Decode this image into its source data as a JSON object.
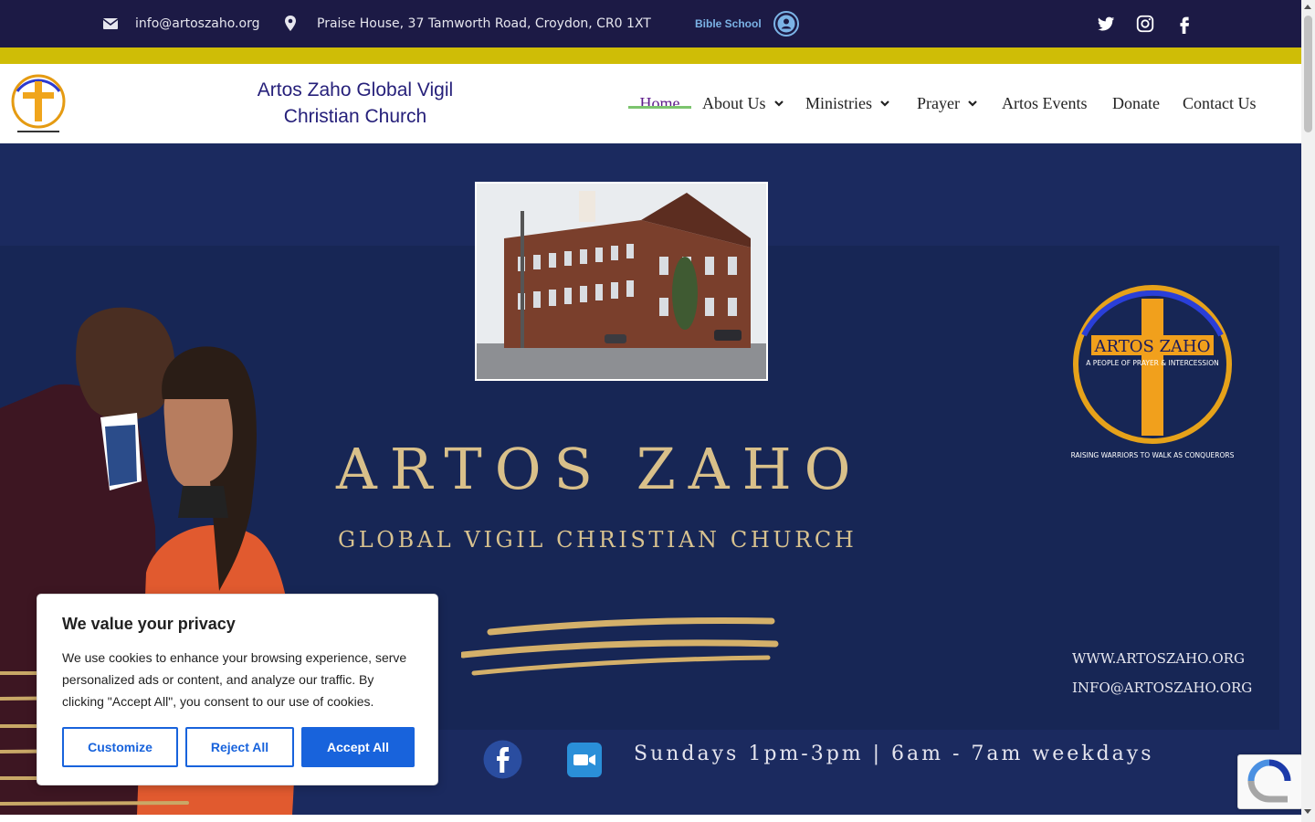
{
  "topbar": {
    "email": "info@artoszaho.org",
    "address": "Praise House, 37 Tamworth Road, Croydon, CR0 1XT",
    "bible_school": "Bible School",
    "social": [
      "twitter-icon",
      "instagram-icon",
      "facebook-icon"
    ]
  },
  "header": {
    "site_name_line1": "Artos Zaho Global Vigil",
    "site_name_line2": "Christian Church",
    "nav": {
      "home": "Home",
      "about": "About Us",
      "ministries": "Ministries",
      "prayer": "Prayer",
      "events": "Artos Events",
      "donate": "Donate",
      "contact": "Contact Us"
    }
  },
  "hero": {
    "title": "ARTOS ZAHO",
    "subtitle": "GLOBAL VIGIL CHRISTIAN CHURCH",
    "logo_text": "ARTOS ZAHO",
    "logo_tagline": "A PEOPLE OF PRAYER & INTERCESSION",
    "logo_motto": "RAISING WARRIORS TO WALK AS CONQUERORS",
    "website": "WWW.ARTOSZAHO.ORG",
    "email": "INFO@ARTOSZAHO.ORG",
    "schedule": "Sundays 1pm-3pm | 6am - 7am weekdays"
  },
  "cookie": {
    "title": "We value your privacy",
    "body": "We use cookies to enhance your browsing experience, serve personalized ads or content, and analyze our traffic. By clicking \"Accept All\", you consent to our use of cookies.",
    "customize": "Customize",
    "reject": "Reject All",
    "accept": "Accept All"
  },
  "colors": {
    "topbar": "#1c1a45",
    "accent_yellow": "#cfbd06",
    "brand_navy": "#26207a",
    "hero_bg": "#1b2a5f",
    "gold": "#d9c08a",
    "button_blue": "#1863dc",
    "nav_underline": "#7cc46e"
  }
}
